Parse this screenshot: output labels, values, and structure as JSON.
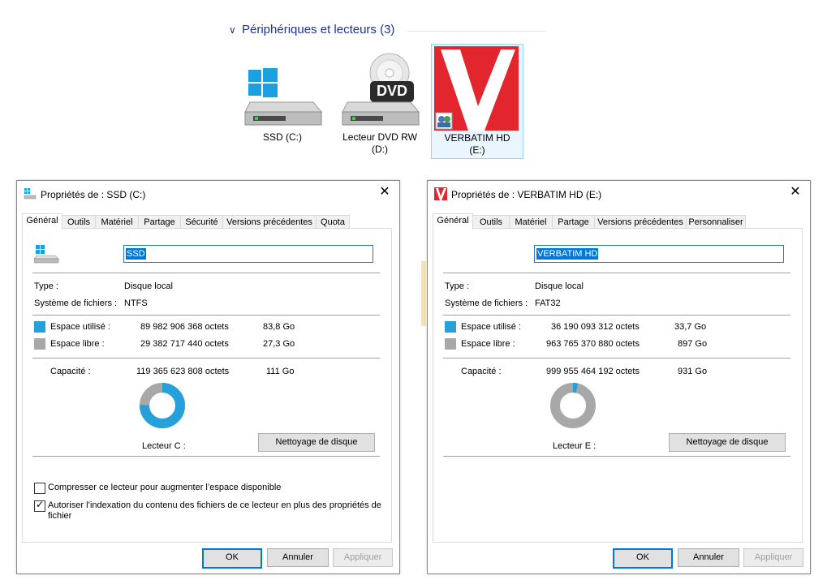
{
  "explorer": {
    "section_title": "Périphériques et lecteurs (3)",
    "drives": [
      {
        "line1": "SSD (C:)",
        "line2": ""
      },
      {
        "line1": "Lecteur DVD RW",
        "line2": "(D:)",
        "badge": "DVD"
      },
      {
        "line1": "VERBATIM HD",
        "line2": "(E:)"
      }
    ]
  },
  "dialog_c": {
    "title": "Propriétés de : SSD (C:)",
    "tabs": [
      "Général",
      "Outils",
      "Matériel",
      "Partage",
      "Sécurité",
      "Versions précédentes",
      "Quota"
    ],
    "name_value": "SSD",
    "type_label": "Type :",
    "type_value": "Disque local",
    "fs_label": "Système de fichiers :",
    "fs_value": "NTFS",
    "used_label": "Espace utilisé :",
    "used_bytes": "89 982 906 368 octets",
    "used_short": "83,8 Go",
    "free_label": "Espace libre :",
    "free_bytes": "29 382 717 440 octets",
    "free_short": "27,3 Go",
    "cap_label": "Capacité :",
    "cap_bytes": "119 365 623 808 octets",
    "cap_short": "111 Go",
    "drive_label": "Lecteur C :",
    "cleanup_button": "Nettoyage de disque",
    "compress_label": "Compresser ce lecteur pour augmenter l’espace disponible",
    "index_label_1": "Autoriser l’indexation du contenu des fichiers de ce lecteur en plus des propriétés de",
    "index_label_2": "fichier",
    "used_fraction": 0.7538,
    "ok": "OK",
    "cancel": "Annuler",
    "apply": "Appliquer"
  },
  "dialog_e": {
    "title": "Propriétés de : VERBATIM HD (E:)",
    "tabs": [
      "Général",
      "Outils",
      "Matériel",
      "Partage",
      "Versions précédentes",
      "Personnaliser"
    ],
    "name_value": "VERBATIM HD",
    "type_label": "Type :",
    "type_value": "Disque local",
    "fs_label": "Système de fichiers :",
    "fs_value": "FAT32",
    "used_label": "Espace utilisé :",
    "used_bytes": "36 190 093 312 octets",
    "used_short": "33,7 Go",
    "free_label": "Espace libre :",
    "free_bytes": "963 765 370 880 octets",
    "free_short": "897 Go",
    "cap_label": "Capacité :",
    "cap_bytes": "999 955 464 192 octets",
    "cap_short": "931 Go",
    "drive_label": "Lecteur E :",
    "cleanup_button": "Nettoyage de disque",
    "used_fraction": 0.0362,
    "ok": "OK",
    "cancel": "Annuler",
    "apply": "Appliquer"
  },
  "colors": {
    "used": "#26a0da",
    "free": "#a8a8a8",
    "accent": "#0078d7",
    "verbatim_red": "#e3262e"
  }
}
